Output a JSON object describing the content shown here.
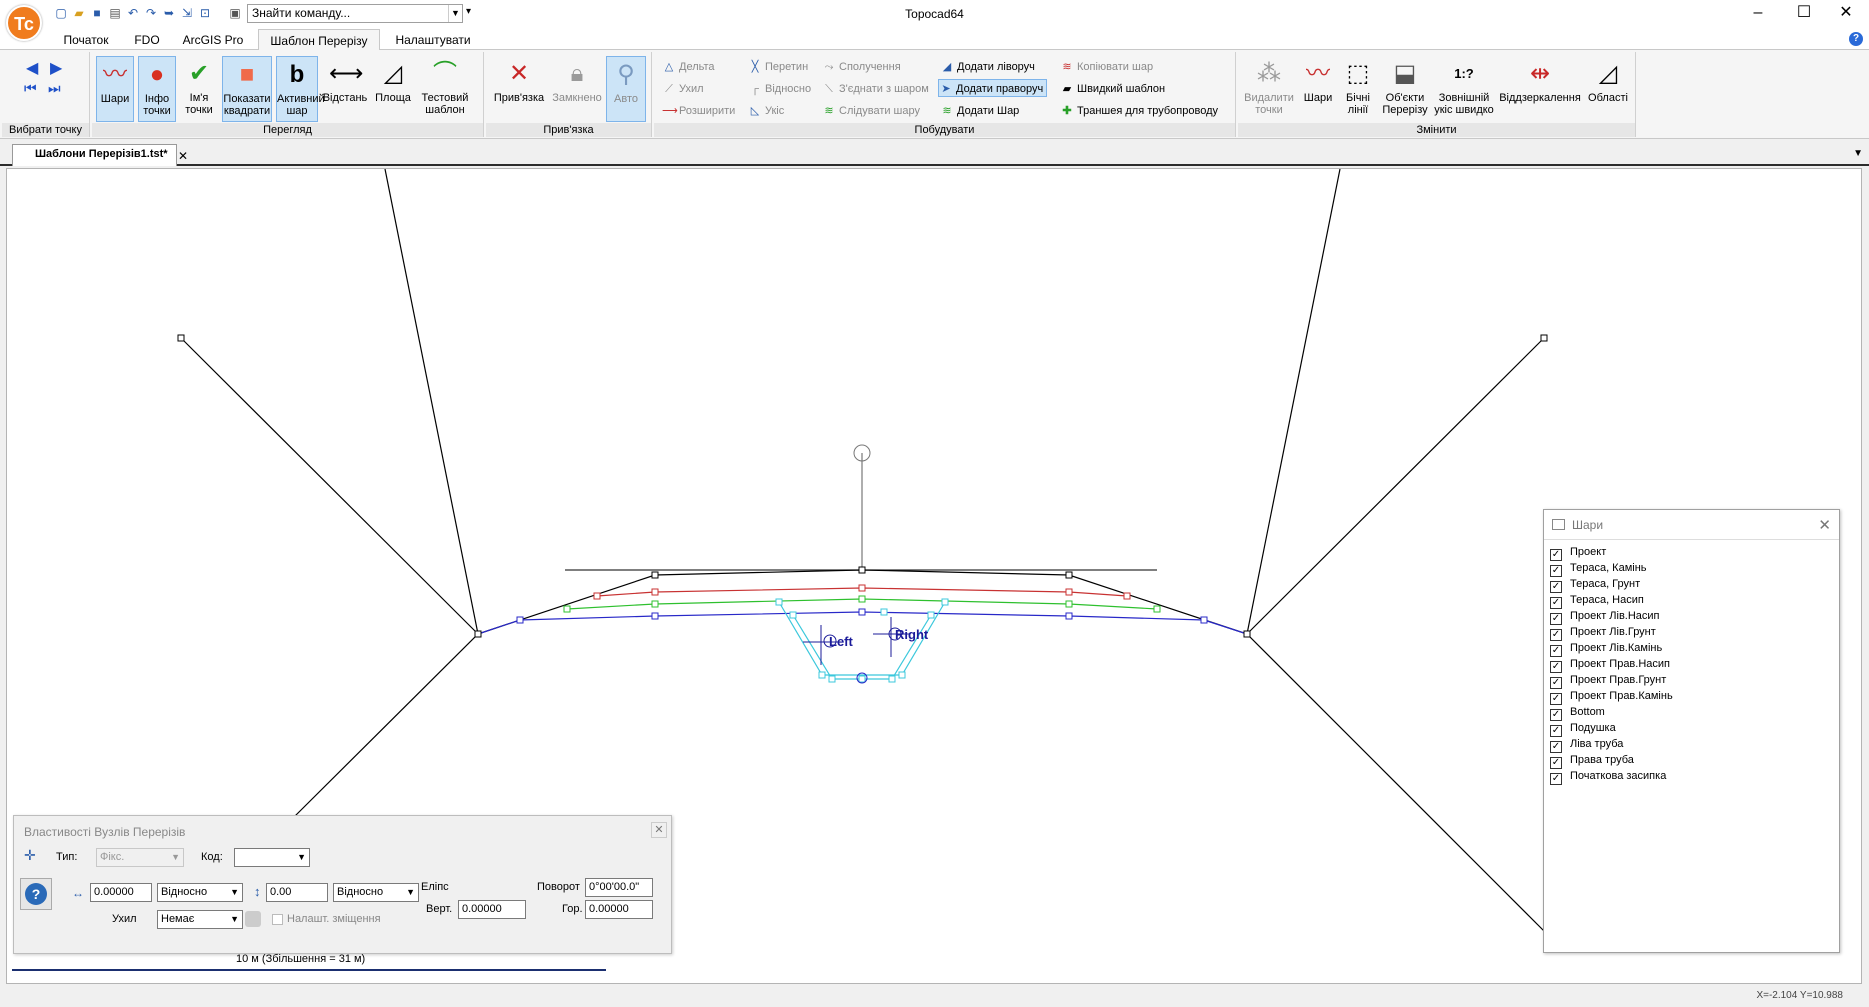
{
  "app": {
    "title": "Topocad64",
    "logo_text": "Tc"
  },
  "quick_access": {
    "search_placeholder": "Знайти команду..."
  },
  "ribbon_tabs": [
    "Початок",
    "FDO",
    "ArcGIS Pro",
    "Шаблон Перерізу",
    "Налаштувати"
  ],
  "ribbon": {
    "groups": {
      "select_point": "Вибрати точку",
      "view": "Перегляд",
      "snap": "Прив'язка",
      "build": "Побудувати",
      "modify": "Змінити"
    },
    "view_buttons": [
      "Шари",
      "Інфо\nточки",
      "Ім'я\nточки",
      "Показати\nквадрати",
      "Активний\nшар",
      "Відстань",
      "Площа",
      "Тестовий\nшаблон"
    ],
    "snap_buttons": [
      "Прив'язка",
      "Замкнено",
      "Авто"
    ],
    "build_col1": [
      "Дельта",
      "Ухил",
      "Розширити"
    ],
    "build_col2": [
      "Перетин",
      "Відносно",
      "Укіс"
    ],
    "build_col3": [
      "Сполучення",
      "З'єднати з шаром",
      "Слідувати шару"
    ],
    "build_col4": [
      "Додати ліворуч",
      "Додати праворуч",
      "Додати Шар"
    ],
    "build_col5": [
      "Копіювати шар",
      "Швидкий шаблон",
      "Траншея для трубопроводу"
    ],
    "modify_buttons": [
      "Видалити\nточки",
      "Шари",
      "Бічні\nлінії",
      "Об'єкти\nПерерізу",
      "Зовнішній\nукіс швидко",
      "Віддзеркалення",
      "Області"
    ],
    "modify_slope_glyph": "1:?"
  },
  "document": {
    "tab_title": "Шаблони Перерізів1.tst*"
  },
  "canvas": {
    "label_left": "Left",
    "label_right": "Right"
  },
  "layers_panel": {
    "title": "Шари",
    "items": [
      "Проект",
      "Тераса, Камінь",
      "Тераса, Грунт",
      "Тераса, Насип",
      "Проект Лів.Насип",
      "Проект Лів.Грунт",
      "Проект Лів.Камінь",
      "Проект Прав.Насип",
      "Проект Прав.Грунт",
      "Проект Прав.Камінь",
      "Bottom",
      "Подушка",
      "Ліва труба",
      "Права труба",
      "Початкова засипка"
    ]
  },
  "node_props": {
    "title": "Властивості Вузлів Перерізів",
    "type_label": "Тип:",
    "type_value": "Фікс.",
    "code_label": "Код:",
    "code_value": "",
    "h_value": "0.00000",
    "h_mode": "Відносно",
    "v_value": "0.00",
    "v_mode": "Відносно",
    "slope_label": "Ухил",
    "slope_value": "Немає",
    "offset_label": "Налашт. зміщення",
    "ellipse_label": "Еліпс",
    "vert_label": "Верт.",
    "vert_value": "0.00000",
    "rotation_label": "Поворот",
    "rotation_value": "0°00'00.0\"",
    "hor_label": "Гор.",
    "hor_value": "0.00000"
  },
  "scale": {
    "label": "10 м (Збільшення = 31 м)"
  },
  "status": {
    "coords": "X=-2.104 Y=10.988"
  },
  "colors": {
    "accent": "#f07c1e",
    "pressed": "#cce4f7",
    "layer_black": "#000000",
    "layer_red": "#c83232",
    "layer_green": "#2ec02e",
    "layer_blue": "#2828c8",
    "layer_cyan": "#3cc8dc"
  }
}
